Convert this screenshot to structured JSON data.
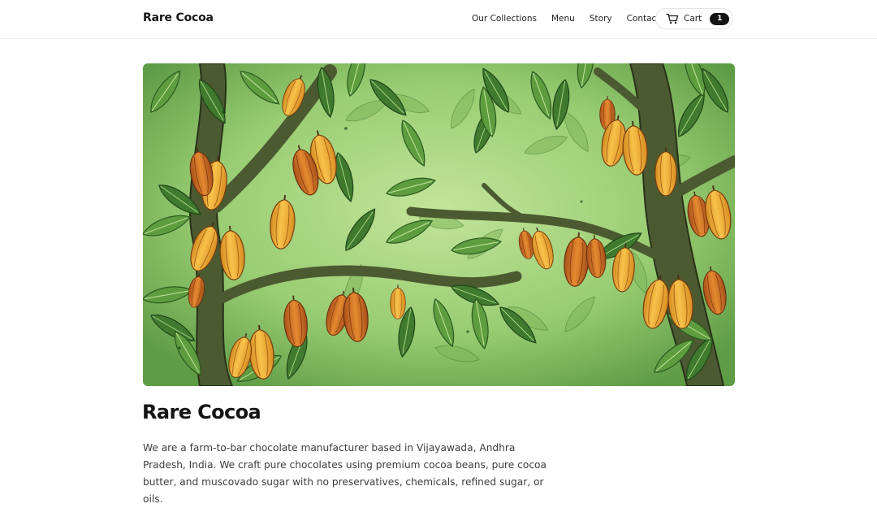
{
  "header": {
    "brand": "Rare Cocoa",
    "nav": [
      {
        "label": "Our Collections"
      },
      {
        "label": "Menu"
      },
      {
        "label": "Story"
      },
      {
        "label": "Contact"
      }
    ],
    "cart": {
      "label": "Cart",
      "count": "1",
      "icon": "cart-icon"
    }
  },
  "hero": {
    "image": "cocoa-tree-illustration"
  },
  "main": {
    "title": "Rare Cocoa",
    "description": "We are a farm-to-bar chocolate manufacturer based in Vijayawada, Andhra Pradesh, India. We craft pure chocolates using premium cocoa beans, pure cocoa butter, and muscovado sugar with no preservatives, chemicals, refined sugar, or oils."
  },
  "colors": {
    "accent": "#141414",
    "pod": "#e59a2b",
    "leaf": "#4d8a3a",
    "background": "#9ccf7a"
  }
}
